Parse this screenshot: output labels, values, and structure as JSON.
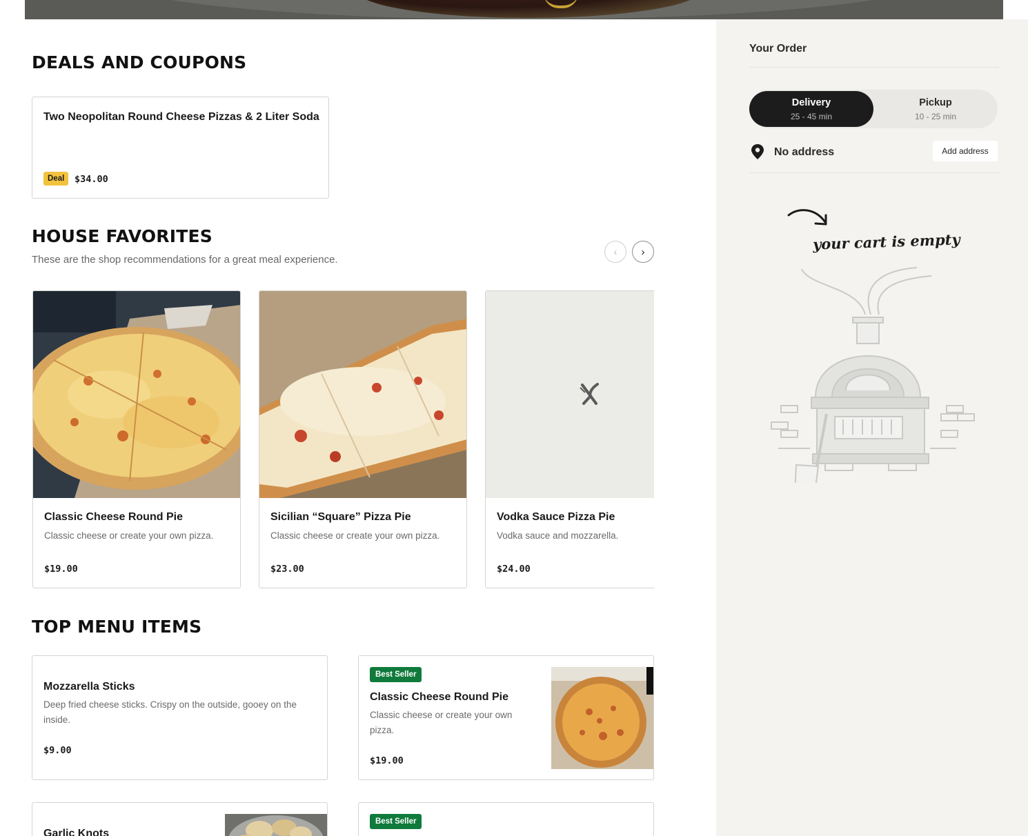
{
  "deals": {
    "title": "DEALS AND COUPONS",
    "items": [
      {
        "name": "Two Neopolitan Round Cheese Pizzas & 2 Liter Soda",
        "badge": "Deal",
        "price": "$34.00"
      }
    ]
  },
  "favorites": {
    "title": "HOUSE FAVORITES",
    "subtitle": "These are the shop recommendations for a great meal experience.",
    "prev_glyph": "‹",
    "next_glyph": "›",
    "items": [
      {
        "name": "Classic Cheese Round Pie",
        "description": "Classic cheese or create your own pizza.",
        "price": "$19.00"
      },
      {
        "name": "Sicilian “Square” Pizza Pie",
        "description": "Classic cheese or create your own pizza.",
        "price": "$23.00"
      },
      {
        "name": "Vodka Sauce Pizza Pie",
        "description": "Vodka sauce and mozzarella.",
        "price": "$24.00"
      }
    ]
  },
  "top_menu": {
    "title": "TOP MENU ITEMS",
    "items": [
      {
        "name": "Mozzarella Sticks",
        "description": "Deep fried cheese sticks. Crispy on the outside, gooey on the inside.",
        "price": "$9.00"
      },
      {
        "badge": "Best Seller",
        "name": "Classic Cheese Round Pie",
        "description": "Classic cheese or create your own pizza.",
        "price": "$19.00"
      },
      {
        "name": "Garlic Knots"
      },
      {
        "badge": "Best Seller"
      }
    ]
  },
  "order": {
    "title": "Your Order",
    "delivery_label": "Delivery",
    "delivery_time": "25 - 45 min",
    "pickup_label": "Pickup",
    "pickup_time": "10 - 25 min",
    "address": "No address",
    "add_address": "Add address",
    "empty_cart": "your cart is empty"
  },
  "colors": {
    "deal_badge": "#f3c23d",
    "best_seller_badge": "#0f7a3b",
    "sidebar_bg": "#f4f3f0",
    "toggle_active": "#1c1c1c"
  }
}
